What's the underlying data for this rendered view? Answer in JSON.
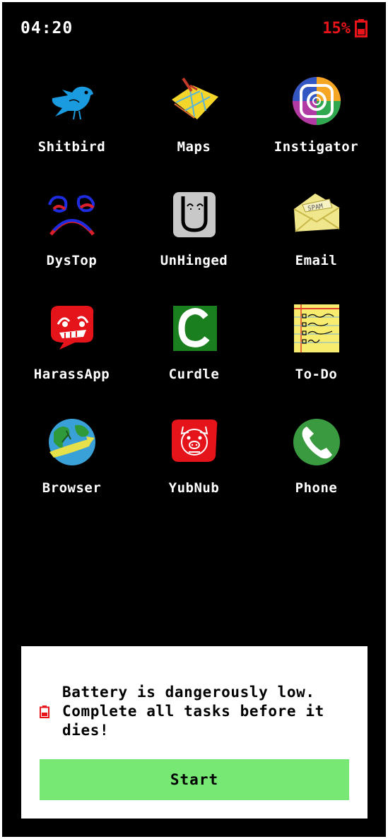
{
  "status_bar": {
    "time": "04:20",
    "battery_percent": "15%",
    "battery_icon": "battery-low-icon",
    "battery_color": "#e8141a"
  },
  "apps": [
    {
      "label": "Shitbird",
      "icon": "bird-icon"
    },
    {
      "label": "Maps",
      "icon": "map-icon"
    },
    {
      "label": "Instigator",
      "icon": "camera-swirl-icon"
    },
    {
      "label": "DysTop",
      "icon": "frown-face-icon"
    },
    {
      "label": "UnHinged",
      "icon": "u-face-icon"
    },
    {
      "label": "Email",
      "icon": "spam-envelope-icon"
    },
    {
      "label": "HarassApp",
      "icon": "chat-bubble-face-icon"
    },
    {
      "label": "Curdle",
      "icon": "c-letter-icon"
    },
    {
      "label": "To-Do",
      "icon": "notepad-checklist-icon"
    },
    {
      "label": "Browser",
      "icon": "globe-icon"
    },
    {
      "label": "YubNub",
      "icon": "pig-face-icon"
    },
    {
      "label": "Phone",
      "icon": "phone-handset-icon"
    }
  ],
  "alert": {
    "icon": "battery-low-icon",
    "message": "Battery is dangerously low. Complete all tasks before it dies!",
    "button_label": "Start",
    "button_color": "#77e874"
  }
}
